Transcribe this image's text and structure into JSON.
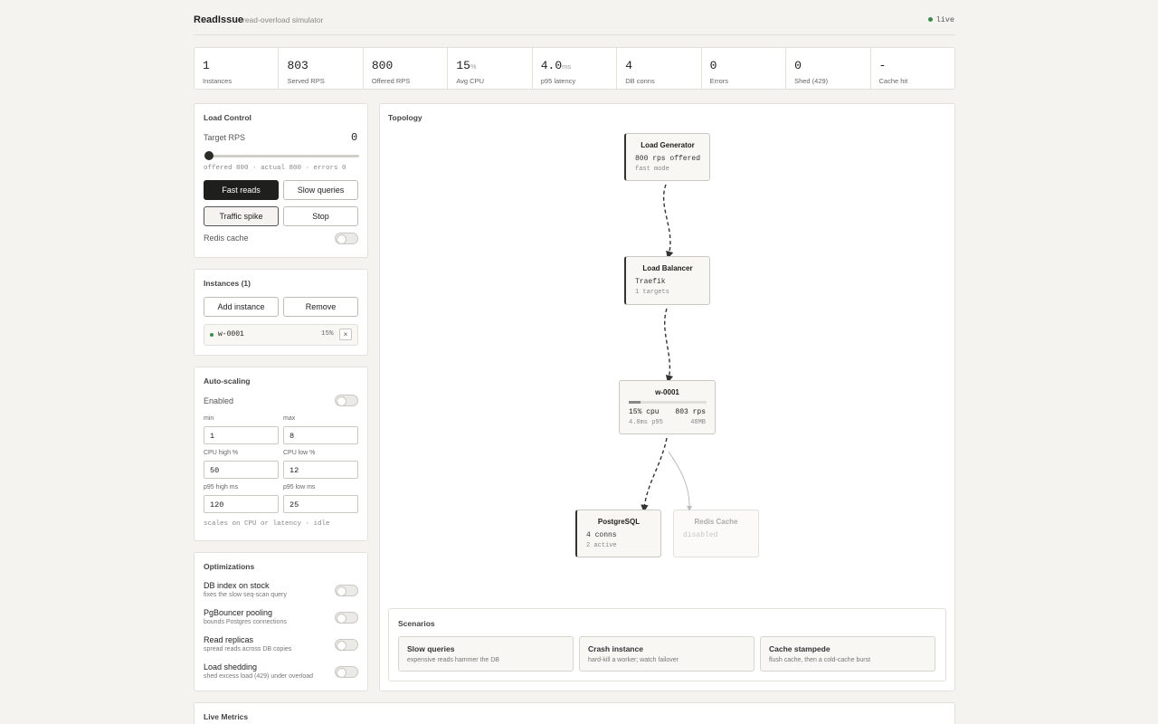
{
  "header": {
    "brand": "ReadIssue",
    "subtitle": "read-overload simulator",
    "status": "live"
  },
  "stats": [
    {
      "value": "1",
      "unit": "",
      "label": "Instances"
    },
    {
      "value": "803",
      "unit": "",
      "label": "Served RPS"
    },
    {
      "value": "800",
      "unit": "",
      "label": "Offered RPS"
    },
    {
      "value": "15",
      "unit": "%",
      "label": "Avg CPU"
    },
    {
      "value": "4.0",
      "unit": "ms",
      "label": "p95 latency"
    },
    {
      "value": "4",
      "unit": "",
      "label": "DB conns"
    },
    {
      "value": "0",
      "unit": "",
      "label": "Errors"
    },
    {
      "value": "0",
      "unit": "",
      "label": "Shed (429)"
    },
    {
      "value": "-",
      "unit": "",
      "label": "Cache hit"
    }
  ],
  "load_control": {
    "title": "Load Control",
    "target_label": "Target RPS",
    "target_value": "0",
    "slider_fraction": 0,
    "summary": "offered 800 · actual 800 · errors 0",
    "buttons": {
      "fast_reads": "Fast reads",
      "slow_queries": "Slow queries",
      "traffic_spike": "Traffic spike",
      "stop": "Stop"
    },
    "redis_label": "Redis cache"
  },
  "instances": {
    "title": "Instances (1)",
    "add": "Add instance",
    "remove": "Remove",
    "list": [
      {
        "name": "w-0001",
        "cpu": "15%",
        "remove_glyph": "×"
      }
    ]
  },
  "autoscaling": {
    "title": "Auto-scaling",
    "enabled_label": "Enabled",
    "fields": {
      "min": {
        "label": "min",
        "value": "1"
      },
      "max": {
        "label": "max",
        "value": "8"
      },
      "cpu_high": {
        "label": "CPU high %",
        "value": "50"
      },
      "cpu_low": {
        "label": "CPU low %",
        "value": "12"
      },
      "p95_high": {
        "label": "p95 high ms",
        "value": "120"
      },
      "p95_low": {
        "label": "p95 low ms",
        "value": "25"
      }
    },
    "note": "scales on CPU or latency · idle"
  },
  "optimizations": {
    "title": "Optimizations",
    "items": [
      {
        "name": "DB index on stock",
        "desc": "fixes the slow seq-scan query"
      },
      {
        "name": "PgBouncer pooling",
        "desc": "bounds Postgres connections"
      },
      {
        "name": "Read replicas",
        "desc": "spread reads across DB copies"
      },
      {
        "name": "Load shedding",
        "desc": "shed excess load (429) under overload"
      }
    ]
  },
  "topology": {
    "title": "Topology",
    "load_generator": {
      "title": "Load Generator",
      "line": "800 rps offered",
      "sub": "fast mode"
    },
    "load_balancer": {
      "title": "Load Balancer",
      "line": "Traefik",
      "sub": "1 targets"
    },
    "worker": {
      "title": "w-0001",
      "cpu": "15% cpu",
      "rps": "803 rps",
      "p95": "4.0ms p95",
      "mem": "48MB",
      "cpu_fraction": 0.15
    },
    "postgres": {
      "title": "PostgreSQL",
      "line": "4 conns",
      "sub": "2 active"
    },
    "redis": {
      "title": "Redis Cache",
      "line": "disabled"
    }
  },
  "scenarios": {
    "title": "Scenarios",
    "items": [
      {
        "title": "Slow queries",
        "desc": "expensive reads hammer the DB"
      },
      {
        "title": "Crash instance",
        "desc": "hard-kill a worker; watch failover"
      },
      {
        "title": "Cache stampede",
        "desc": "flush cache, then a cold-cache burst"
      }
    ]
  },
  "live_metrics": {
    "title": "Live Metrics"
  }
}
